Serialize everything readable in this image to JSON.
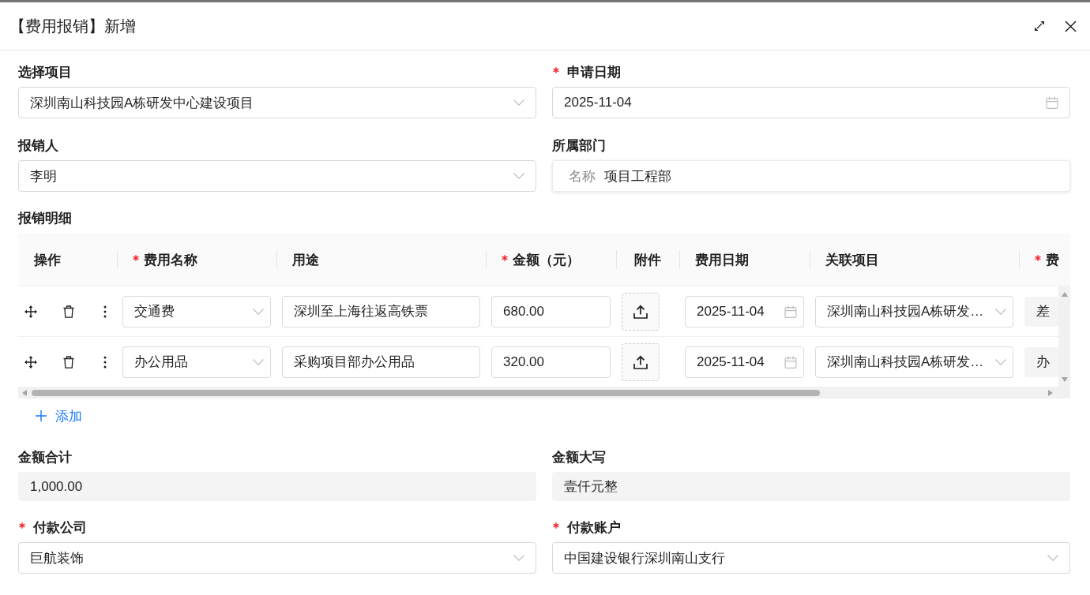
{
  "dialog": {
    "title": "【费用报销】新增"
  },
  "basic_fields": [
    {
      "label": "选择项目",
      "required": false,
      "kind": "select",
      "value": "深圳南山科技园A栋研发中心建设项目"
    },
    {
      "label": "申请日期",
      "required": true,
      "kind": "date",
      "value": "2025-11-04"
    },
    {
      "label": "报销人",
      "required": false,
      "kind": "select",
      "value": "李明"
    },
    {
      "label": "所属部门",
      "required": false,
      "kind": "prefixed",
      "prefix": "名称",
      "value": "项目工程部"
    }
  ],
  "details": {
    "title": "报销明细",
    "columns": [
      {
        "label": "操作",
        "required": false,
        "kind": "actions"
      },
      {
        "label": "费用名称",
        "required": true,
        "kind": "select"
      },
      {
        "label": "用途",
        "required": false,
        "kind": "input"
      },
      {
        "label": "金额（元）",
        "required": true,
        "kind": "input"
      },
      {
        "label": "附件",
        "required": false,
        "kind": "upload"
      },
      {
        "label": "费用日期",
        "required": false,
        "kind": "date"
      },
      {
        "label": "关联项目",
        "required": false,
        "kind": "select"
      },
      {
        "label": "费",
        "required": true,
        "kind": "readonly"
      }
    ],
    "rows": [
      {
        "expense_name": "交通费",
        "purpose": "深圳至上海往返高铁票",
        "amount": "680.00",
        "expense_date": "2025-11-04",
        "related_project": "深圳南山科技园A栋研发…",
        "column_8": "差"
      },
      {
        "expense_name": "办公用品",
        "purpose": "采购项目部办公用品",
        "amount": "320.00",
        "expense_date": "2025-11-04",
        "related_project": "深圳南山科技园A栋研发…",
        "column_8": "办"
      }
    ],
    "add_button": "添加"
  },
  "summary_fields": [
    {
      "label": "金额合计",
      "required": false,
      "kind": "readonly",
      "value": "1,000.00"
    },
    {
      "label": "金额大写",
      "required": false,
      "kind": "readonly",
      "value": "壹仟元整"
    },
    {
      "label": "付款公司",
      "required": true,
      "kind": "select",
      "value": "巨航装饰"
    },
    {
      "label": "付款账户",
      "required": true,
      "kind": "select",
      "value": "中国建设银行深圳南山支行"
    }
  ]
}
